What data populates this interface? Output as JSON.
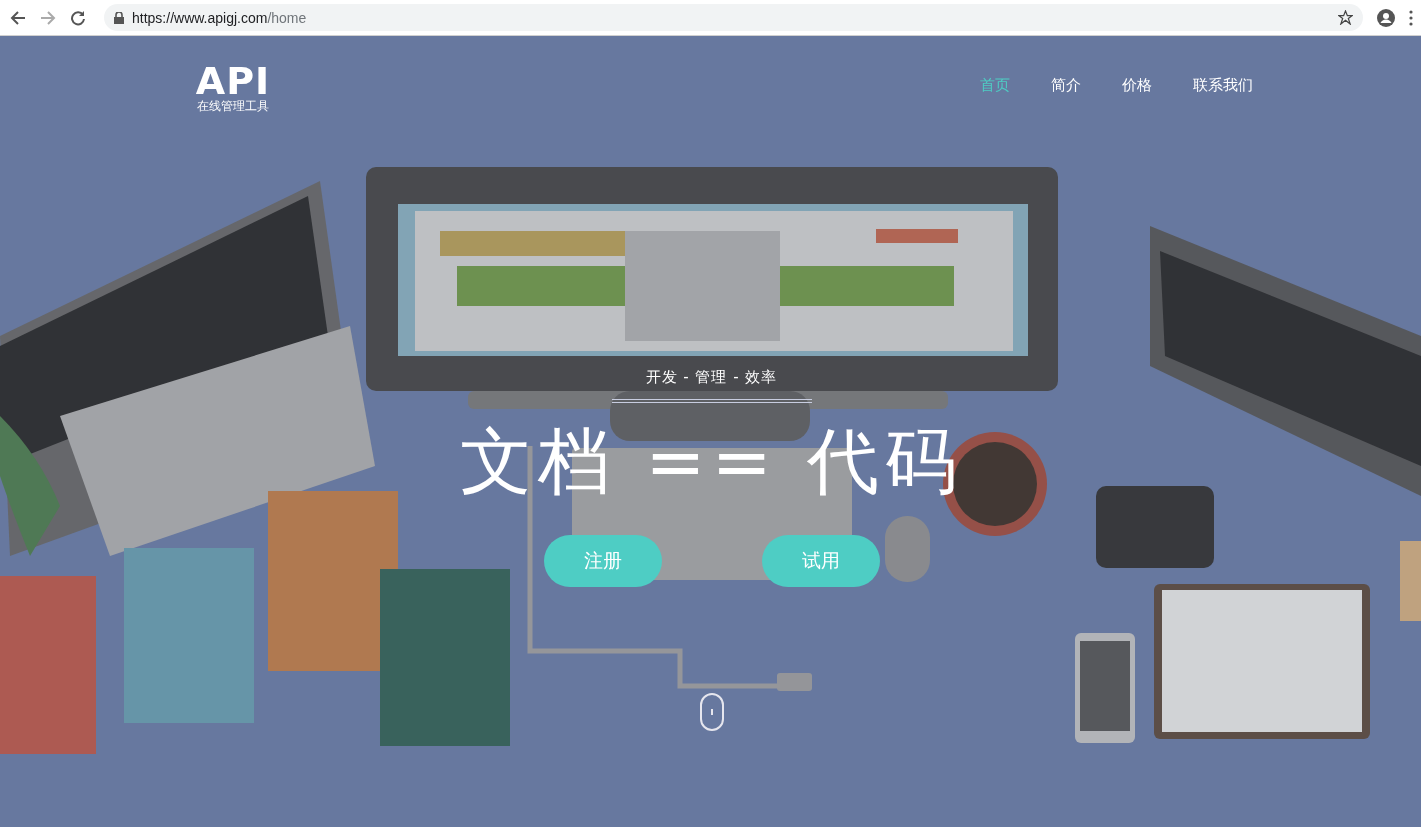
{
  "browser": {
    "url_host": "https://www.apigj.com",
    "url_path": "/home"
  },
  "logo": {
    "mark": "API",
    "subtitle": "在线管理工具"
  },
  "nav": [
    {
      "label": "首页",
      "selected": true
    },
    {
      "label": "简介",
      "selected": false
    },
    {
      "label": "价格",
      "selected": false
    },
    {
      "label": "联系我们",
      "selected": false
    }
  ],
  "hero": {
    "tagline": "开发 - 管理 - 效率",
    "headline": "文档 == 代码",
    "buttons": [
      "注册",
      "试用"
    ]
  }
}
